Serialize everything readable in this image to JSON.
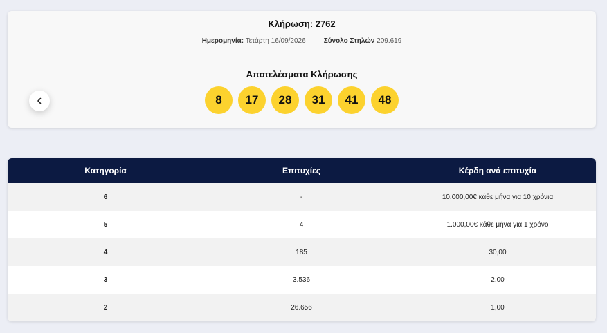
{
  "draw": {
    "title": "Κλήρωση: 2762",
    "date_label": "Ημερομηνία:",
    "date_value": "Τετάρτη 16/09/2026",
    "columns_label": "Σύνολο Στηλών",
    "columns_value": "209.619",
    "results_title": "Αποτελέσματα Κλήρωσης",
    "numbers": [
      "8",
      "17",
      "28",
      "31",
      "41",
      "48"
    ],
    "ball_color": "#fcd22e",
    "prev_icon": "chevron-left-icon"
  },
  "table": {
    "header_color": "#0c1a42",
    "headers": [
      "Κατηγορία",
      "Επιτυχίες",
      "Κέρδη ανά επιτυχία"
    ],
    "rows": [
      {
        "category": "6",
        "winners": "-",
        "prize": "10.000,00€ κάθε μήνα για 10 χρόνια"
      },
      {
        "category": "5",
        "winners": "4",
        "prize": "1.000,00€ κάθε μήνα για 1 χρόνο"
      },
      {
        "category": "4",
        "winners": "185",
        "prize": "30,00"
      },
      {
        "category": "3",
        "winners": "3.536",
        "prize": "2,00"
      },
      {
        "category": "2",
        "winners": "26.656",
        "prize": "1,00"
      }
    ]
  }
}
